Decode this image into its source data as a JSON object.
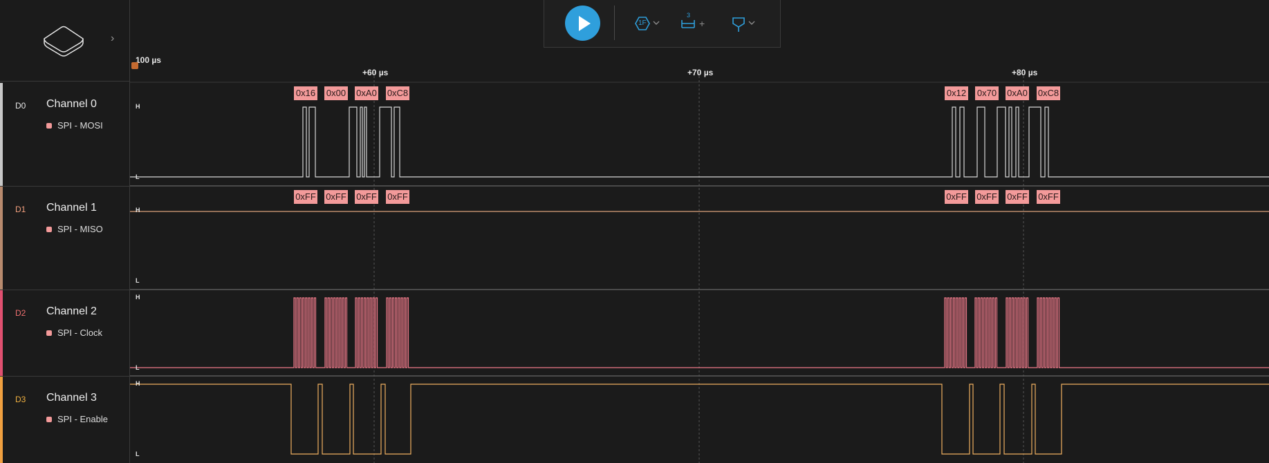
{
  "timeline": {
    "start_label": "100 µs",
    "ticks": [
      "+60 µs",
      "+70 µs",
      "+80 µs"
    ]
  },
  "channels": [
    {
      "id": "D0",
      "name": "Channel 0",
      "analyzer": "SPI - MOSI",
      "color": "#c8c8c8",
      "dcolor": "#e6e6e6",
      "trace": "#d8d8d8",
      "high": "H",
      "low": "L"
    },
    {
      "id": "D1",
      "name": "Channel 1",
      "analyzer": "SPI - MISO",
      "color": "#b88a6e",
      "dcolor": "#f3a07e",
      "trace": "#d9a07a",
      "high": "H",
      "low": "L"
    },
    {
      "id": "D2",
      "name": "Channel 2",
      "analyzer": "SPI - Clock",
      "color": "#e05070",
      "dcolor": "#f07070",
      "trace": "#f07a8a",
      "high": "H",
      "low": "L"
    },
    {
      "id": "D3",
      "name": "Channel 3",
      "analyzer": "SPI - Enable",
      "color": "#f0a040",
      "dcolor": "#f0b040",
      "trace": "#f0b060",
      "high": "H",
      "low": "L"
    }
  ],
  "decoded": {
    "mosi": [
      "0x16",
      "0x00",
      "0xA0",
      "0xC8",
      "0x12",
      "0x70",
      "0xA0",
      "0xC8"
    ],
    "miso": [
      "0xFF",
      "0xFF",
      "0xFF",
      "0xFF",
      "0xFF",
      "0xFF",
      "0xFF",
      "0xFF"
    ]
  },
  "toolbar": {
    "trigger_badge": "1F",
    "measure_badge": "3",
    "measure_plus": "+"
  },
  "colors": {
    "accent": "#2f9fdc",
    "label_bg": "#f39a9a",
    "background": "#1b1b1b"
  }
}
